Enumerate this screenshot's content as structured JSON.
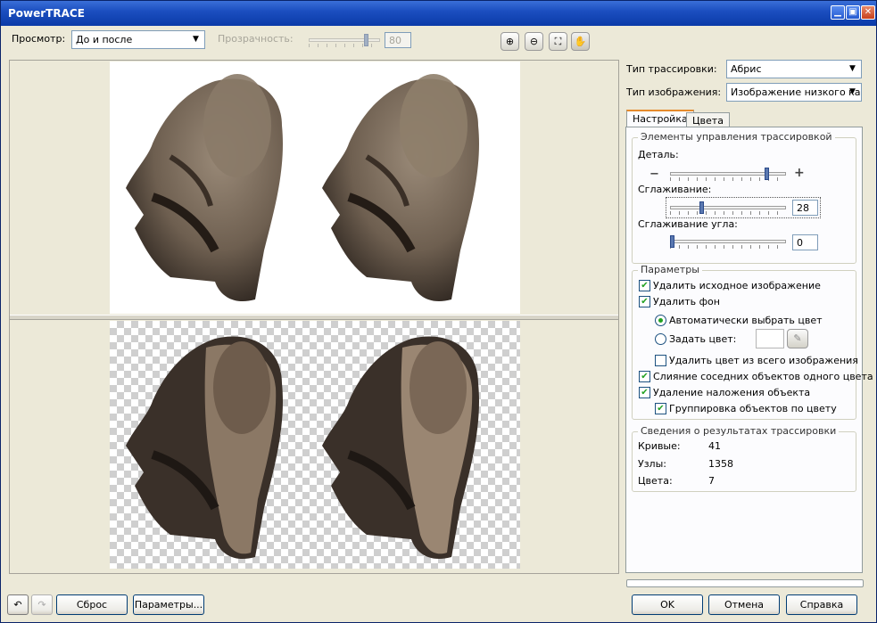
{
  "window": {
    "title": "PowerTRACE",
    "min_icon": "minimize-icon",
    "max_icon": "maximize-icon",
    "close_icon": "close-icon"
  },
  "toolbar": {
    "preview_label": "Просмотр:",
    "preview_value": "До и после",
    "transparency_label": "Прозрачность:",
    "transparency_value": "80",
    "tools": [
      "zoom-in-icon",
      "zoom-out-icon",
      "fit-icon",
      "pan-hand-icon"
    ]
  },
  "right_panel": {
    "trace_type_label": "Тип трассировки:",
    "trace_type_value": "Абрис",
    "image_type_label": "Тип изображения:",
    "image_type_value": "Изображение низкого кач",
    "tabs": [
      "Настройка",
      "Цвета"
    ],
    "controls_group": "Элементы управления трассировкой",
    "detail_label": "Деталь:",
    "detail_level": 0.85,
    "smoothing_label": "Сглаживание:",
    "smoothing_value": "28",
    "corner_label": "Сглаживание угла:",
    "corner_value": "0",
    "options_group": "Параметры",
    "opt_delete_original": "Удалить исходное изображение",
    "opt_remove_bg": "Удалить фон",
    "opt_auto_color": "Автоматически выбрать цвет",
    "opt_set_color": "Задать цвет:",
    "opt_remove_color_all": "Удалить цвет из всего изображения",
    "opt_merge": "Слияние соседних объектов одного цвета",
    "opt_overlap": "Удаление наложения объекта",
    "opt_group": "Группировка объектов по цвету",
    "results_group": "Сведения о результатах трассировки",
    "curves_label": "Кривые:",
    "curves_value": "41",
    "nodes_label": "Узлы:",
    "nodes_value": "1358",
    "colors_label": "Цвета:",
    "colors_value": "7"
  },
  "footer": {
    "reset": "Сброс",
    "options": "Параметры...",
    "ok": "OK",
    "cancel": "Отмена",
    "help": "Справка",
    "undo_icon": "undo-icon",
    "redo_icon": "redo-icon"
  }
}
